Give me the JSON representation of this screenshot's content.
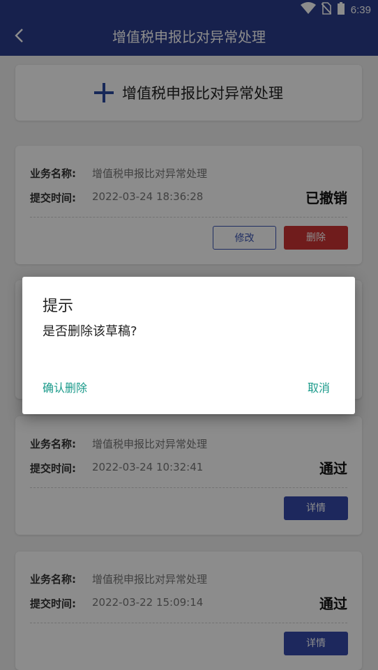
{
  "status_bar": {
    "time": "6:39"
  },
  "app_bar": {
    "title": "增值税申报比对异常处理"
  },
  "add_card": {
    "label": "增值税申报比对异常处理"
  },
  "labels": {
    "business_name": "业务名称:",
    "submit_time": "提交时间:"
  },
  "records": [
    {
      "name": "增值税申报比对异常处理",
      "time": "2022-03-24 18:36:28",
      "status": "已撤销",
      "buttons": [
        "修改",
        "删除"
      ]
    },
    {
      "name": "增值税申报比对异常处理",
      "time": "2022-03-24 10:32:41",
      "status": "通过",
      "buttons": [
        "详情"
      ]
    },
    {
      "name": "增值税申报比对异常处理",
      "time": "2022-03-22 15:09:14",
      "status": "通过",
      "buttons": [
        "详情"
      ]
    }
  ],
  "dialog": {
    "title": "提示",
    "message": "是否删除该草稿?",
    "confirm": "确认删除",
    "cancel": "取消"
  },
  "colors": {
    "primary": "#2b3c8c",
    "danger": "#cc3333",
    "accent": "#1a9a8a"
  },
  "icons": [
    "back-arrow-icon",
    "wifi-icon",
    "no-sim-icon",
    "battery-icon",
    "plus-icon"
  ]
}
